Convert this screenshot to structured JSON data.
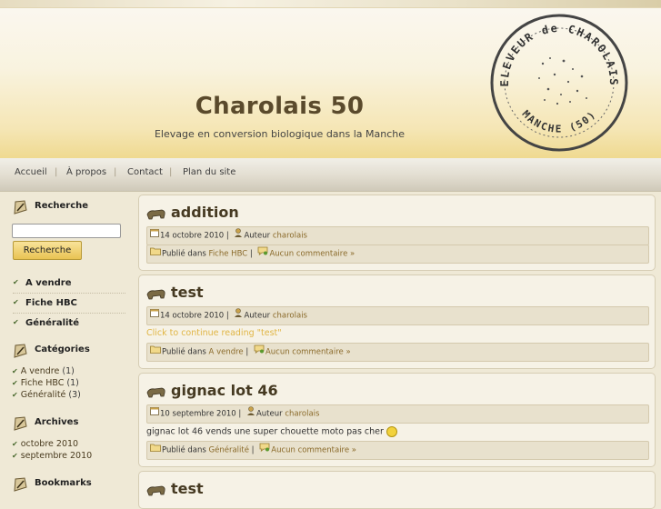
{
  "site": {
    "title": "Charolais 50",
    "description": "Elevage en conversion biologique dans la Manche",
    "stamp": {
      "top": "ELEVEUR de CHAROLAIS",
      "bottom": "MANCHE (50)"
    }
  },
  "nav": {
    "items": [
      "Accueil",
      "À propos",
      "Contact",
      "Plan du site"
    ],
    "separator": "|"
  },
  "sidebar": {
    "search": {
      "heading": "Recherche",
      "value": "",
      "button": "Recherche"
    },
    "pages": [
      "A vendre",
      "Fiche HBC",
      "Généralité"
    ],
    "categories": {
      "heading": "Catégories",
      "items": [
        {
          "name": "A vendre",
          "count": "(1)"
        },
        {
          "name": "Fiche HBC",
          "count": "(1)"
        },
        {
          "name": "Généralité",
          "count": "(3)"
        }
      ]
    },
    "archives": {
      "heading": "Archives",
      "items": [
        "octobre 2010",
        "septembre 2010"
      ]
    },
    "bookmarks": {
      "heading": "Bookmarks"
    }
  },
  "posts": [
    {
      "title": "addition",
      "date": "14 octobre 2010",
      "author_label": "Auteur",
      "author": "charolais",
      "published_label": "Publié dans",
      "category": "Fiche HBC",
      "comments": "Aucun commentaire »"
    },
    {
      "title": "test",
      "date": "14 octobre 2010",
      "author_label": "Auteur",
      "author": "charolais",
      "excerpt": "Click to continue reading \"test\"",
      "published_label": "Publié dans",
      "category": "A vendre",
      "comments": "Aucun commentaire »"
    },
    {
      "title": "gignac lot 46",
      "date": "10 septembre 2010",
      "author_label": "Auteur",
      "author": "charolais",
      "excerpt": "gignac lot 46 vends une super chouette moto pas cher",
      "published_label": "Publié dans",
      "category": "Généralité",
      "comments": "Aucun commentaire »"
    },
    {
      "title": "test"
    }
  ],
  "colors": {
    "accent": "#e0b544",
    "link": "#8a6a2a",
    "title": "#5a4a2c"
  }
}
